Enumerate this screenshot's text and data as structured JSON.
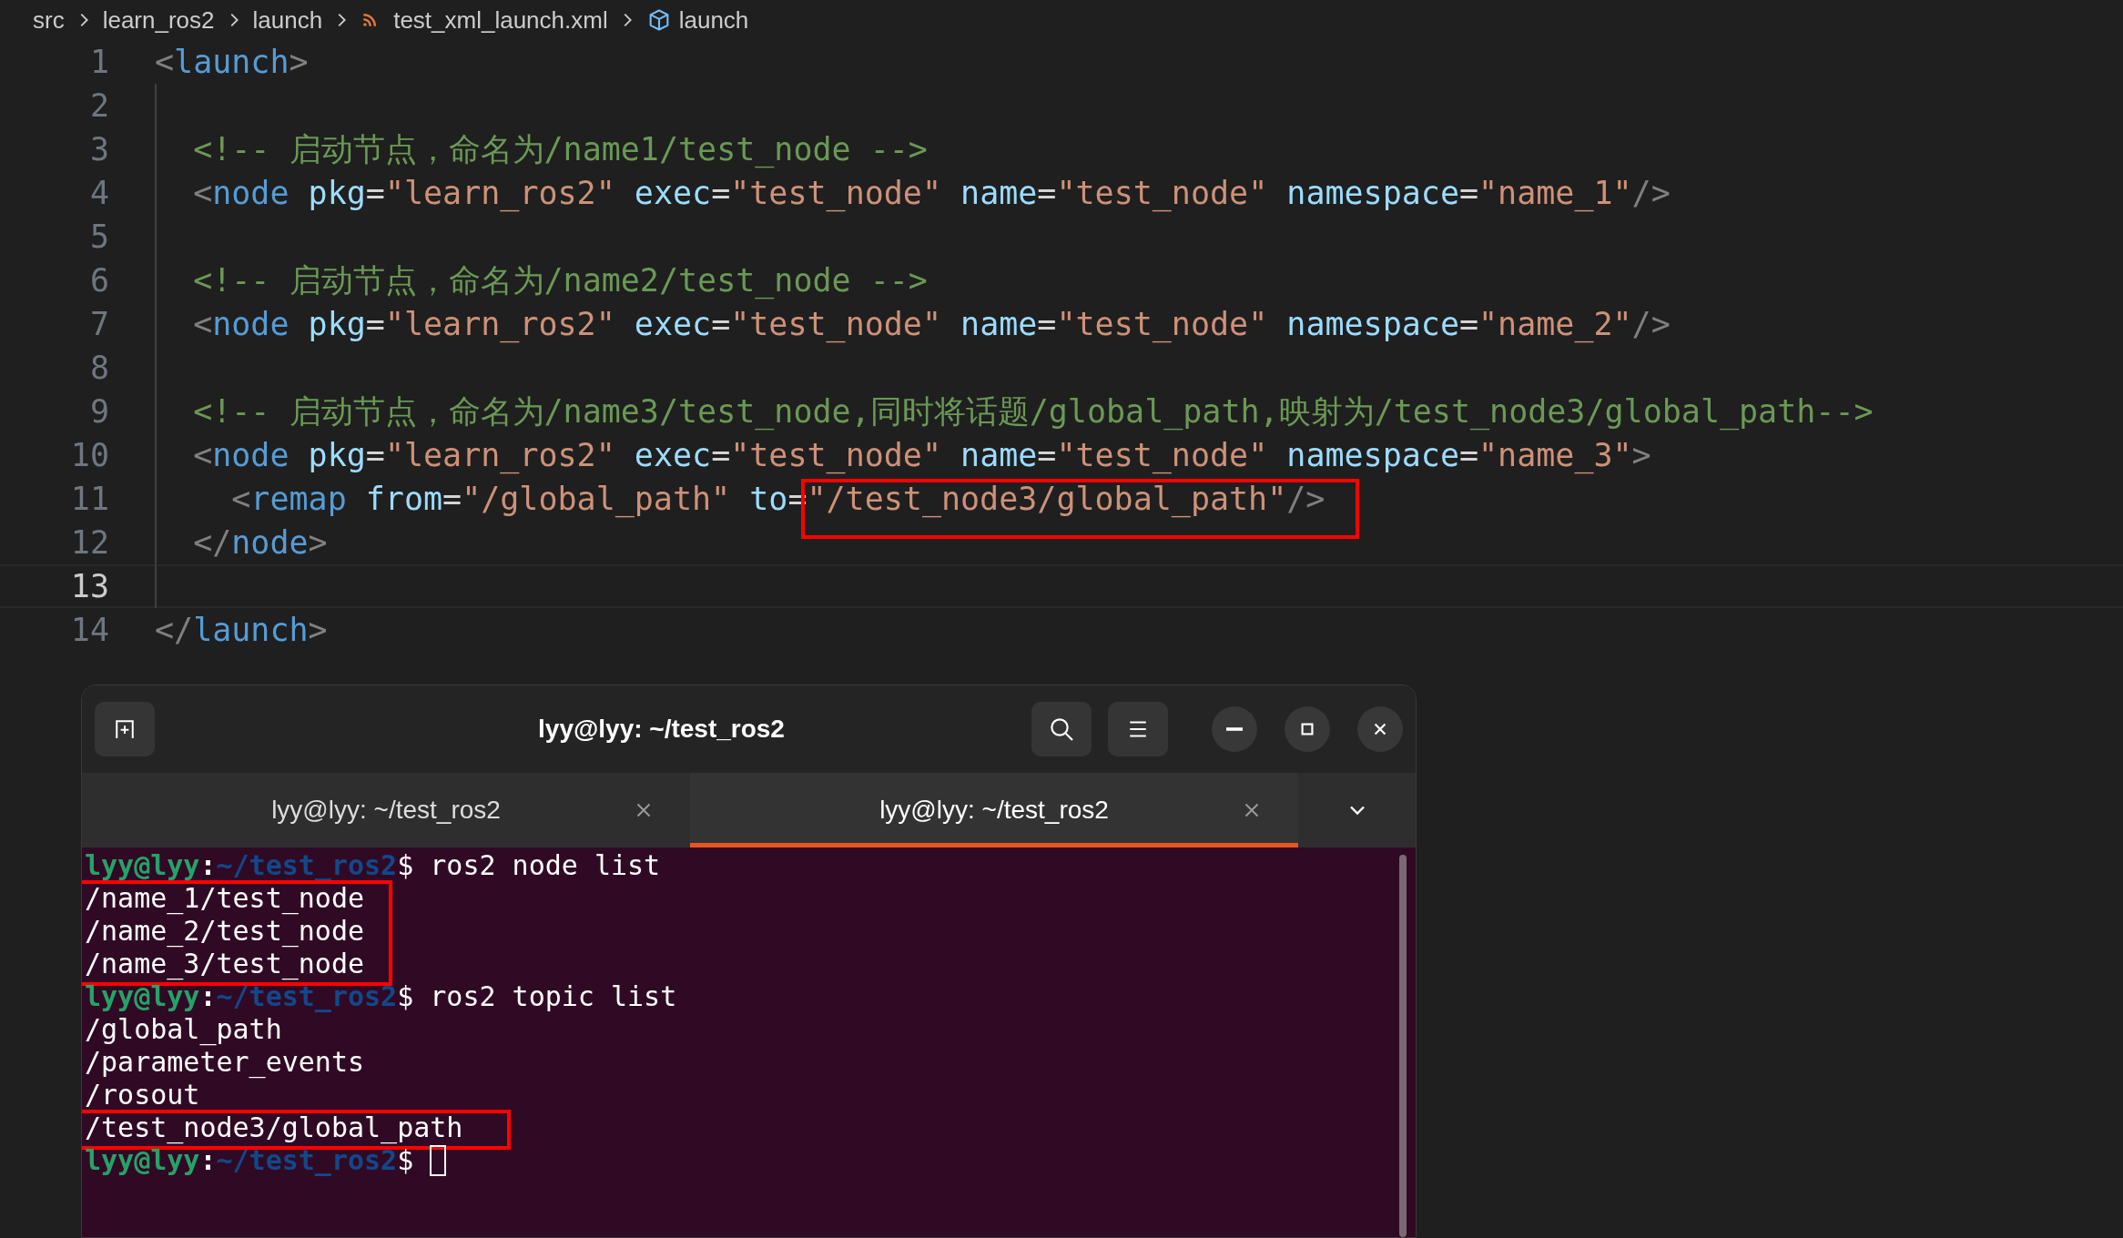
{
  "breadcrumb": [
    {
      "text": "src"
    },
    {
      "text": "learn_ros2"
    },
    {
      "text": "launch"
    },
    {
      "text": "test_xml_launch.xml"
    },
    {
      "text": "launch"
    }
  ],
  "editor": {
    "lines": [
      {
        "number": "1",
        "current": false,
        "tokens": [
          {
            "kind": "p",
            "text": "<"
          },
          {
            "kind": "t",
            "text": "launch"
          },
          {
            "kind": "p",
            "text": ">"
          }
        ]
      },
      {
        "number": "2",
        "current": false
      },
      {
        "number": "3",
        "current": false,
        "tokens": [
          {
            "kind": "c",
            "text": "  <!-- 启动节点，命名为/name1/test_node -->"
          }
        ]
      },
      {
        "number": "4",
        "current": false,
        "tokens": [
          {
            "kind": "p",
            "text": "  <"
          },
          {
            "kind": "t",
            "text": "node"
          },
          {
            "kind": "a",
            "text": " pkg"
          },
          {
            "kind": "o",
            "text": "="
          },
          {
            "kind": "s",
            "text": "\"learn_ros2\""
          },
          {
            "kind": "a",
            "text": " exec"
          },
          {
            "kind": "o",
            "text": "="
          },
          {
            "kind": "s",
            "text": "\"test_node\""
          },
          {
            "kind": "a",
            "text": " name"
          },
          {
            "kind": "o",
            "text": "="
          },
          {
            "kind": "s",
            "text": "\"test_node\""
          },
          {
            "kind": "a",
            "text": " namespace"
          },
          {
            "kind": "o",
            "text": "="
          },
          {
            "kind": "s",
            "text": "\"name_1\""
          },
          {
            "kind": "p",
            "text": "/>"
          }
        ]
      },
      {
        "number": "5",
        "current": false
      },
      {
        "number": "6",
        "current": false,
        "tokens": [
          {
            "kind": "c",
            "text": "  <!-- 启动节点，命名为/name2/test_node -->"
          }
        ]
      },
      {
        "number": "7",
        "current": false,
        "tokens": [
          {
            "kind": "p",
            "text": "  <"
          },
          {
            "kind": "t",
            "text": "node"
          },
          {
            "kind": "a",
            "text": " pkg"
          },
          {
            "kind": "o",
            "text": "="
          },
          {
            "kind": "s",
            "text": "\"learn_ros2\""
          },
          {
            "kind": "a",
            "text": " exec"
          },
          {
            "kind": "o",
            "text": "="
          },
          {
            "kind": "s",
            "text": "\"test_node\""
          },
          {
            "kind": "a",
            "text": " name"
          },
          {
            "kind": "o",
            "text": "="
          },
          {
            "kind": "s",
            "text": "\"test_node\""
          },
          {
            "kind": "a",
            "text": " namespace"
          },
          {
            "kind": "o",
            "text": "="
          },
          {
            "kind": "s",
            "text": "\"name_2\""
          },
          {
            "kind": "p",
            "text": "/>"
          }
        ]
      },
      {
        "number": "8",
        "current": false
      },
      {
        "number": "9",
        "current": false,
        "tokens": [
          {
            "kind": "c",
            "text": "  <!-- 启动节点，命名为/name3/test_node,同时将话题/global_path,映射为/test_node3/global_path-->"
          }
        ]
      },
      {
        "number": "10",
        "current": false,
        "tokens": [
          {
            "kind": "p",
            "text": "  <"
          },
          {
            "kind": "t",
            "text": "node"
          },
          {
            "kind": "a",
            "text": " pkg"
          },
          {
            "kind": "o",
            "text": "="
          },
          {
            "kind": "s",
            "text": "\"learn_ros2\""
          },
          {
            "kind": "a",
            "text": " exec"
          },
          {
            "kind": "o",
            "text": "="
          },
          {
            "kind": "s",
            "text": "\"test_node\""
          },
          {
            "kind": "a",
            "text": " name"
          },
          {
            "kind": "o",
            "text": "="
          },
          {
            "kind": "s",
            "text": "\"test_node\""
          },
          {
            "kind": "a",
            "text": " namespace"
          },
          {
            "kind": "o",
            "text": "="
          },
          {
            "kind": "s",
            "text": "\"name_3\""
          },
          {
            "kind": "p",
            "text": ">"
          }
        ]
      },
      {
        "number": "11",
        "current": false,
        "tokens": [
          {
            "kind": "p",
            "text": "    <"
          },
          {
            "kind": "t",
            "text": "remap"
          },
          {
            "kind": "a",
            "text": " from"
          },
          {
            "kind": "o",
            "text": "="
          },
          {
            "kind": "s",
            "text": "\"/global_path\""
          },
          {
            "kind": "a",
            "text": " to"
          },
          {
            "kind": "o",
            "text": "="
          },
          {
            "kind": "s",
            "text": "\"/test_node3/global_path\"",
            "boxed": true
          },
          {
            "kind": "p",
            "text": "/>"
          }
        ]
      },
      {
        "number": "12",
        "current": false,
        "tokens": [
          {
            "kind": "p",
            "text": "  </"
          },
          {
            "kind": "t",
            "text": "node"
          },
          {
            "kind": "p",
            "text": ">"
          }
        ]
      },
      {
        "number": "13",
        "current": true
      },
      {
        "number": "14",
        "current": false,
        "tokens": [
          {
            "kind": "p",
            "text": "</"
          },
          {
            "kind": "t",
            "text": "launch"
          },
          {
            "kind": "p",
            "text": ">"
          }
        ]
      }
    ]
  },
  "terminal": {
    "title": "lyy@lyy: ~/test_ros2",
    "tabs": [
      {
        "label": "lyy@lyy: ~/test_ros2",
        "selected": false
      },
      {
        "label": "lyy@lyy: ~/test_ros2",
        "selected": true
      }
    ],
    "blocks": [
      {
        "boxed": false,
        "lines": [
          {
            "kind": "prompt",
            "user": "lyy@lyy",
            "sep": ":",
            "path": "~/test_ros2",
            "dollar": "$",
            "command": " ros2 node list"
          }
        ]
      },
      {
        "boxed": true,
        "lines": [
          {
            "kind": "output",
            "text": "/name_1/test_node"
          },
          {
            "kind": "output",
            "text": "/name_2/test_node"
          },
          {
            "kind": "output",
            "text": "/name_3/test_node"
          }
        ]
      },
      {
        "boxed": false,
        "lines": [
          {
            "kind": "prompt",
            "user": "lyy@lyy",
            "sep": ":",
            "path": "~/test_ros2",
            "dollar": "$",
            "command": " ros2 topic list"
          },
          {
            "kind": "output",
            "text": "/global_path"
          },
          {
            "kind": "output",
            "text": "/parameter_events"
          },
          {
            "kind": "output",
            "text": "/rosout"
          }
        ]
      },
      {
        "boxed": true,
        "lines": [
          {
            "kind": "output",
            "text": "/test_node3/global_path"
          }
        ]
      },
      {
        "boxed": false,
        "lines": [
          {
            "kind": "prompt",
            "user": "lyy@lyy",
            "sep": ":",
            "path": "~/test_ros2",
            "dollar": "$",
            "cursor": true
          }
        ]
      }
    ]
  }
}
